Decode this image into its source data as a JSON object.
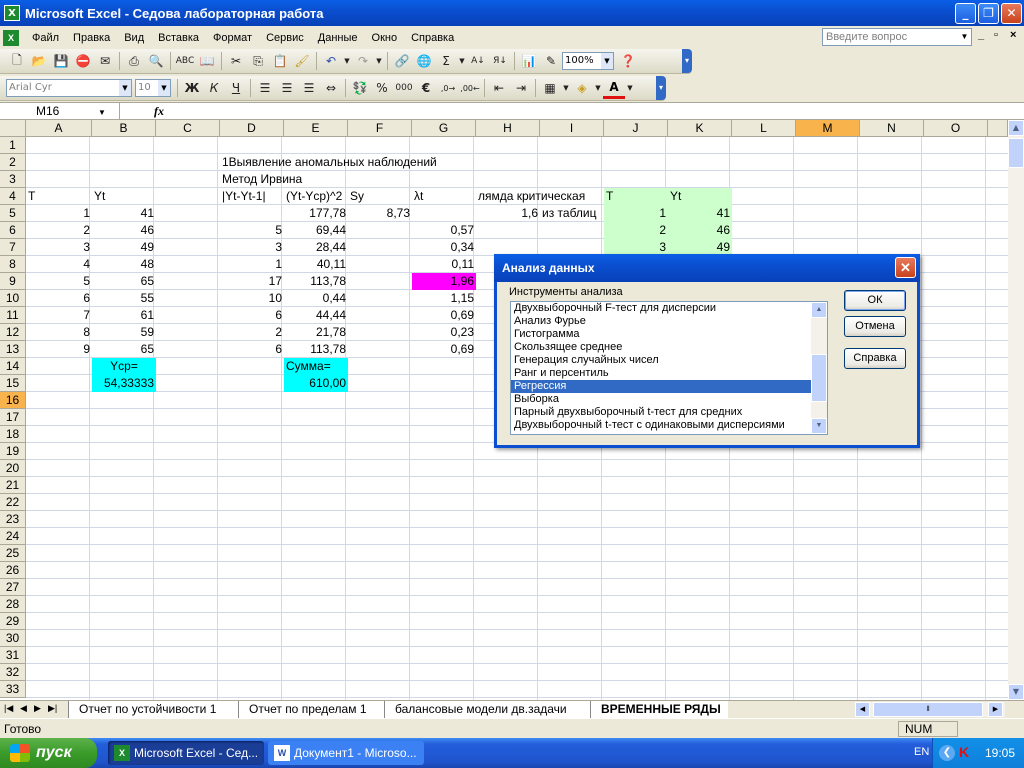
{
  "window": {
    "title": "Microsoft Excel - Седова лабораторная работа",
    "app_icon": "excel-icon",
    "controls": [
      "minimize",
      "restore",
      "close"
    ]
  },
  "menu": {
    "items": [
      "Файл",
      "Правка",
      "Вид",
      "Вставка",
      "Формат",
      "Сервис",
      "Данные",
      "Окно",
      "Справка"
    ],
    "help_placeholder": "Введите вопрос",
    "doc_controls": [
      "_",
      "▫",
      "×"
    ]
  },
  "toolbar_standard": {
    "zoom": "100%",
    "icons": [
      "new-icon",
      "open-icon",
      "save-icon",
      "permission-icon",
      "email-icon",
      "print-icon",
      "print-preview-icon",
      "spelling-icon",
      "research-icon",
      "cut-icon",
      "copy-icon",
      "paste-icon",
      "format-painter-icon",
      "undo-icon",
      "redo-icon",
      "insert-hyperlink-icon",
      "autosum-icon",
      "sort-ascending-icon",
      "sort-descending-icon",
      "chart-wizard-icon",
      "drawing-icon",
      "zoom-combo",
      "help-icon"
    ]
  },
  "toolbar_formatting": {
    "font": "Arial Cyr",
    "size": "10",
    "bold": "Ж",
    "italic": "К",
    "underline": "Ч",
    "percent": "%",
    "thousands": "000",
    "euro": "€",
    "font_color_label": "A"
  },
  "formula_bar": {
    "name_box": "M16",
    "fx_label": "fx",
    "content": ""
  },
  "sheet": {
    "columns": [
      "A",
      "B",
      "C",
      "D",
      "E",
      "F",
      "G",
      "H",
      "I",
      "J",
      "K",
      "L",
      "M",
      "N",
      "O"
    ],
    "selected_column": "M",
    "selected_row": "16",
    "rows": [
      "1",
      "2",
      "3",
      "4",
      "5",
      "6",
      "7",
      "8",
      "9",
      "10",
      "11",
      "12",
      "13",
      "14",
      "15",
      "16",
      "17",
      "18",
      "19",
      "20",
      "21",
      "22",
      "23",
      "24",
      "25",
      "26",
      "27",
      "28",
      "29",
      "30",
      "31",
      "32",
      "33"
    ],
    "cells": {
      "D2": "1Выявление аномальных наблюдений",
      "D3": "Метод Ирвина",
      "A4": "T",
      "B4": "Yt",
      "D4": "|Yt-Yt-1|",
      "E4": "(Yt-Ycp)^2",
      "F4": "Sy",
      "G4": "λt",
      "H4": "лямда критическая",
      "J4": "T",
      "K4": "Yt",
      "A5": "1",
      "B5": "41",
      "E5": "177,78",
      "F5": "8,73",
      "H5": "1,6",
      "I5": "из таблиц",
      "J5": "1",
      "K5": "41",
      "A6": "2",
      "B6": "46",
      "D6": "5",
      "E6": "69,44",
      "G6": "0,57",
      "J6": "2",
      "K6": "46",
      "A7": "3",
      "B7": "49",
      "D7": "3",
      "E7": "28,44",
      "G7": "0,34",
      "J7": "3",
      "K7": "49",
      "A8": "4",
      "B8": "48",
      "D8": "1",
      "E8": "40,11",
      "G8": "0,11",
      "A9": "5",
      "B9": "65",
      "D9": "17",
      "E9": "113,78",
      "G9": "1,96",
      "A10": "6",
      "B10": "55",
      "D10": "10",
      "E10": "0,44",
      "G10": "1,15",
      "A11": "7",
      "B11": "61",
      "D11": "6",
      "E11": "44,44",
      "G11": "0,69",
      "A12": "8",
      "B12": "59",
      "D12": "2",
      "E12": "21,78",
      "G12": "0,23",
      "A13": "9",
      "B13": "65",
      "D13": "6",
      "E13": "113,78",
      "G13": "0,69",
      "B14": "Ycp=",
      "E14": "Сумма=",
      "B15": "54,33333",
      "E15": "610,00"
    },
    "fill_colors": {
      "cyan": "#00ffff",
      "magenta": "#ff00ff",
      "green": "#ccffcc",
      "selected_header": "#f9b34c"
    }
  },
  "sheet_tabs": {
    "tabs": [
      "Отчет по устойчивости 1",
      "Отчет по пределам 1",
      "балансовые модели дв.задачи",
      "ВРЕМЕННЫЕ РЯДЫ"
    ],
    "active_index": 3
  },
  "status": {
    "text": "Готово",
    "num": "NUM"
  },
  "taskbar": {
    "start": "пуск",
    "items": [
      "Microsoft Excel - Сед...",
      "Документ1 - Microso..."
    ],
    "lang": "EN",
    "clock": "19:05"
  },
  "dialog": {
    "title": "Анализ данных",
    "label": "Инструменты анализа",
    "items": [
      "Двухвыборочный F-тест для дисперсии",
      "Анализ Фурье",
      "Гистограмма",
      "Скользящее среднее",
      "Генерация случайных чисел",
      "Ранг и персентиль",
      "Регрессия",
      "Выборка",
      "Парный двухвыборочный t-тест для средних",
      "Двухвыборочный t-тест с одинаковыми дисперсиями"
    ],
    "selected_index": 6,
    "ok": "ОК",
    "cancel": "Отмена",
    "help": "Справка"
  }
}
